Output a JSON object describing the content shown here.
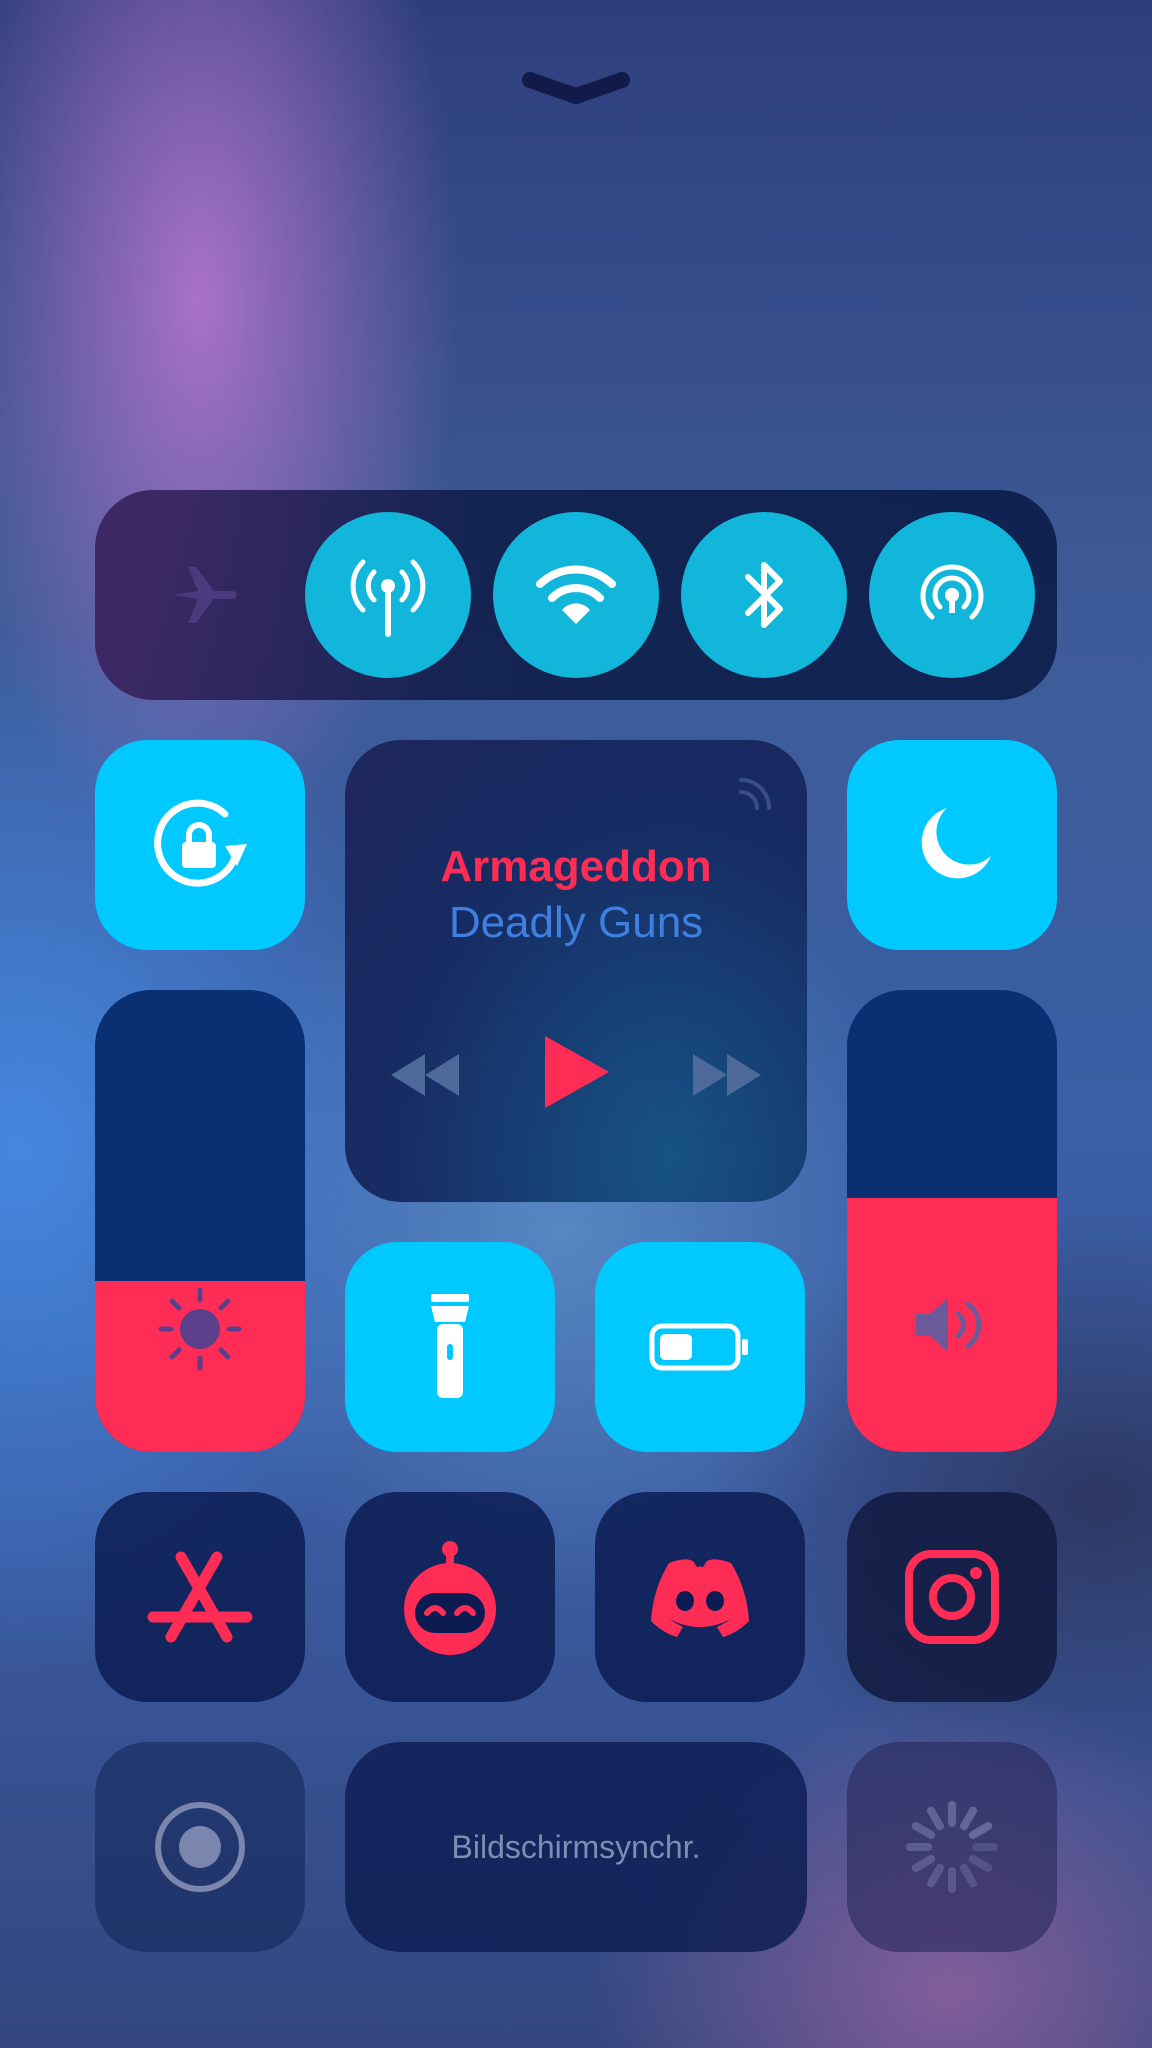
{
  "header": {
    "dismiss_icon": "chevron-down-icon"
  },
  "connectivity": {
    "airplane": {
      "icon": "airplane-icon",
      "active": false
    },
    "cellular": {
      "icon": "antenna-icon",
      "active": true
    },
    "wifi": {
      "icon": "wifi-icon",
      "active": true
    },
    "bluetooth": {
      "icon": "bluetooth-icon",
      "active": true
    },
    "hotspot": {
      "icon": "hotspot-icon",
      "active": true
    }
  },
  "rotation_lock": {
    "icon": "rotation-lock-icon",
    "active": true
  },
  "music": {
    "title": "Armageddon",
    "artist": "Deadly Guns",
    "airplay_icon": "airplay-icon",
    "controls": [
      "rewind-icon",
      "play-icon",
      "fast-forward-icon"
    ]
  },
  "do_not_disturb": {
    "icon": "moon-icon",
    "active": true
  },
  "brightness": {
    "icon": "sun-icon",
    "level": 0.37
  },
  "volume": {
    "icon": "speaker-icon",
    "level": 0.55
  },
  "flashlight": {
    "icon": "flashlight-icon"
  },
  "low_power": {
    "icon": "battery-icon"
  },
  "apps": [
    "app-store-icon",
    "robot-app-icon",
    "discord-icon",
    "instagram-icon"
  ],
  "screen_recording": {
    "icon": "record-icon"
  },
  "screen_mirroring": {
    "label": "Bildschirmsynchr."
  },
  "loading": {
    "icon": "spinner-icon"
  },
  "colors": {
    "accent_cyan": "#00c9ff",
    "accent_red": "#ff2d55",
    "circle_cyan": "#11b6da"
  }
}
